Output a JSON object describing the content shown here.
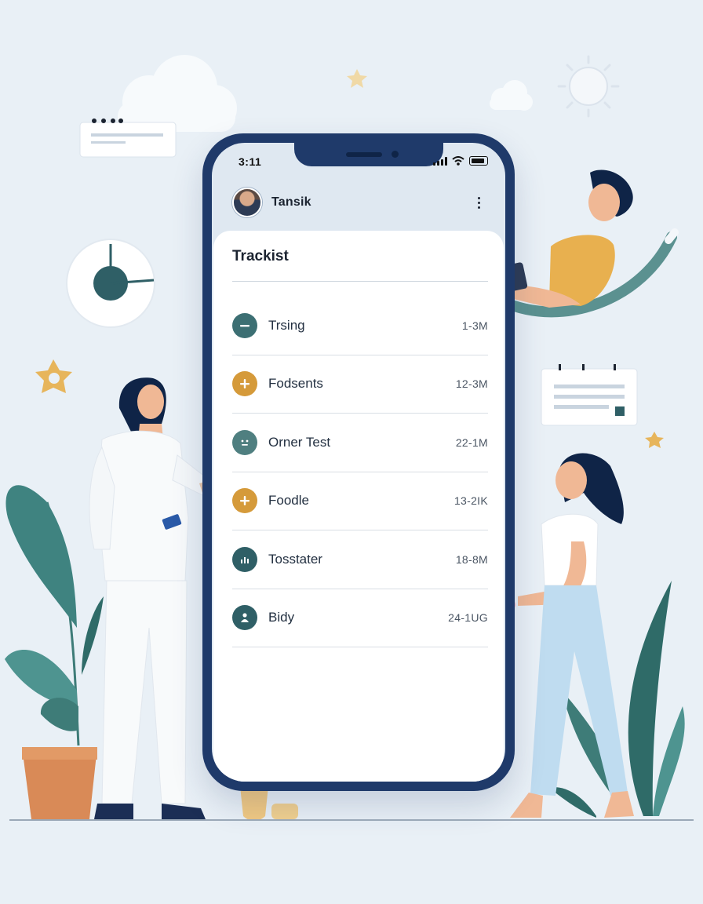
{
  "status_bar": {
    "time": "3:11"
  },
  "app": {
    "name": "Tansik"
  },
  "card": {
    "title": "Trackist"
  },
  "items": [
    {
      "label": "Trsing",
      "meta": "1-3M",
      "icon": "minus-icon",
      "color": "#3c6f73"
    },
    {
      "label": "Fodsents",
      "meta": "12-3M",
      "icon": "plus-icon",
      "color": "#d59a3a"
    },
    {
      "label": "Orner Test",
      "meta": "22-1M",
      "icon": "face-icon",
      "color": "#4f7f80"
    },
    {
      "label": "Foodle",
      "meta": "13-2IK",
      "icon": "plus-icon",
      "color": "#d59a3a"
    },
    {
      "label": "Tosstater",
      "meta": "18-8M",
      "icon": "chart-icon",
      "color": "#2f5f66"
    },
    {
      "label": "Bidy",
      "meta": "24-1UG",
      "icon": "person-icon",
      "color": "#2f5f66"
    }
  ],
  "colors": {
    "phone_frame": "#1f3a6a",
    "background": "#e9f0f6",
    "accent_teal": "#3c6f73",
    "accent_gold": "#d59a3a"
  }
}
